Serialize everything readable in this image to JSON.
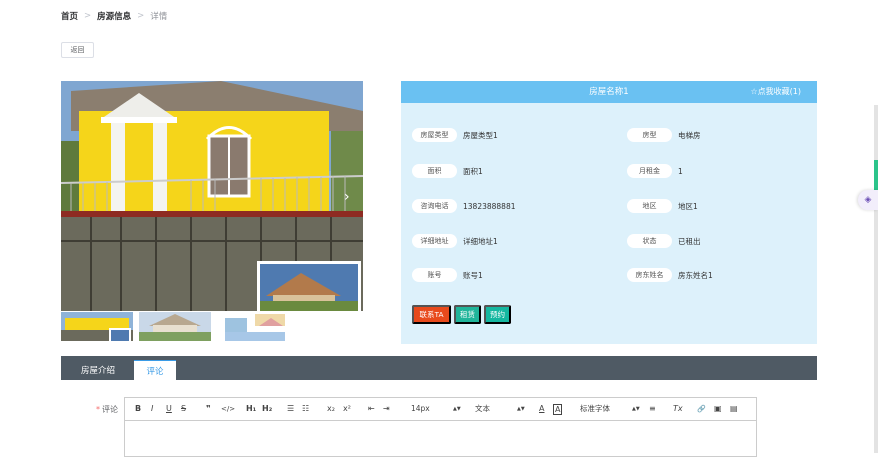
{
  "breadcrumb": {
    "home": "首页",
    "section": "房源信息",
    "current": "详情",
    "sep": ">"
  },
  "back_label": "返回",
  "house": {
    "title": "房屋名称1",
    "favorite_label": "☆点我收藏(1)",
    "fields": [
      {
        "label": "房屋类型",
        "value": "房屋类型1"
      },
      {
        "label": "房型",
        "value": "电梯房"
      },
      {
        "label": "面积",
        "value": "面积1"
      },
      {
        "label": "月租金",
        "value": "1"
      },
      {
        "label": "咨询电话",
        "value": "13823888881"
      },
      {
        "label": "地区",
        "value": "地区1"
      },
      {
        "label": "详细地址",
        "value": "详细地址1"
      },
      {
        "label": "状态",
        "value": "已租出"
      },
      {
        "label": "账号",
        "value": "账号1"
      },
      {
        "label": "房东姓名",
        "value": "房东姓名1"
      }
    ],
    "actions": {
      "contact": "联系TA",
      "rent": "租赁",
      "reserve": "预约"
    }
  },
  "tabs": {
    "intro": "房屋介绍",
    "comments": "评论"
  },
  "comment": {
    "label": "评论",
    "required_mark": "*",
    "toolbar": {
      "bold": "B",
      "italic": "I",
      "underline": "U",
      "strike": "S",
      "quote": "❞",
      "code": "</>",
      "h1": "H₁",
      "h2": "H₂",
      "ol": "☰",
      "ul": "☷",
      "sub": "x₂",
      "sup": "x²",
      "outdent": "⇤",
      "indent": "⇥",
      "size": "14px",
      "text_type": "文本",
      "font": "标准字体",
      "align": "≡",
      "clear": "Tx",
      "link": "🔗",
      "image": "▣",
      "video": "▤"
    }
  },
  "colors": {
    "header_bar": "#6ac1f2",
    "info_bg": "#ddf1fb",
    "contact": "#e84a1c",
    "rent": "#20b59a",
    "reserve": "#15b7a0",
    "tabs_bar": "#4f5a64",
    "accent": "#3a9be6"
  }
}
